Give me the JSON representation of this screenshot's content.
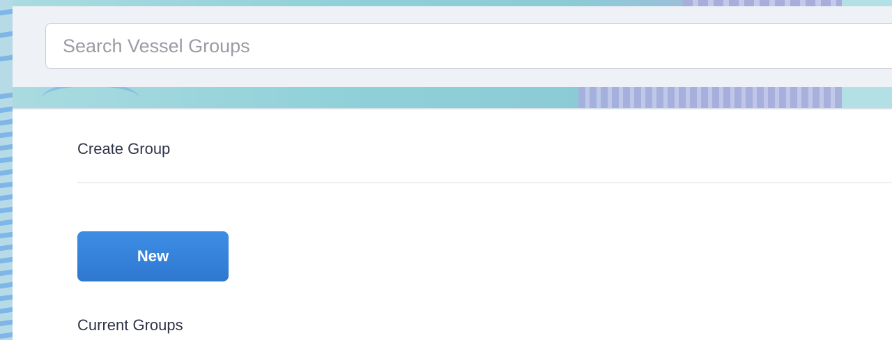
{
  "search": {
    "placeholder": "Search Vessel Groups",
    "value": ""
  },
  "create_section": {
    "title": "Create Group",
    "new_button_label": "New"
  },
  "current_section": {
    "title": "Current Groups"
  },
  "colors": {
    "primary_button": "#3589de",
    "text": "#2f3348",
    "search_panel_bg": "#eef1f6"
  }
}
